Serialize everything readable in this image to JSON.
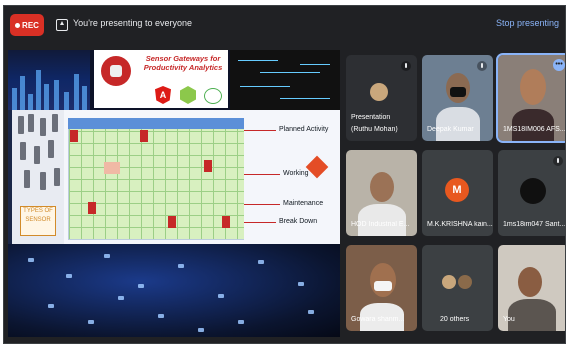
{
  "topbar": {
    "rec_label": "REC",
    "presenting_text": "You're presenting to everyone",
    "stop_label": "Stop presenting"
  },
  "slide": {
    "title_line1": "Sensor Gateways for",
    "title_line2": "Productivity Analytics",
    "angular_letter": "A",
    "sensor_box_text": "TYPES OF SENSOR",
    "legend": [
      "Planned Activity",
      "Working",
      "Maintenance",
      "Break Down"
    ]
  },
  "participants": [
    {
      "name": "Presentation",
      "subname": "(Ruthu Mohan)",
      "muted": true
    },
    {
      "name": "Deepak Kumar",
      "muted": false
    },
    {
      "name": "1MS18IM006 AFS...",
      "muted": false
    },
    {
      "name": "HOD Industrial E...",
      "muted": false
    },
    {
      "name": "M.K.KRISHNA kain...",
      "avatar_letter": "M",
      "muted": false
    },
    {
      "name": "1ms18im047 Sant...",
      "muted": true
    },
    {
      "name": "Gowara shanm...",
      "muted": false
    },
    {
      "name": "20 others",
      "muted": false
    },
    {
      "name": "You",
      "muted": false
    }
  ],
  "colors": {
    "rec": "#d93025",
    "stop": "#8ab4f8",
    "avatar_m": "#e8581f"
  }
}
